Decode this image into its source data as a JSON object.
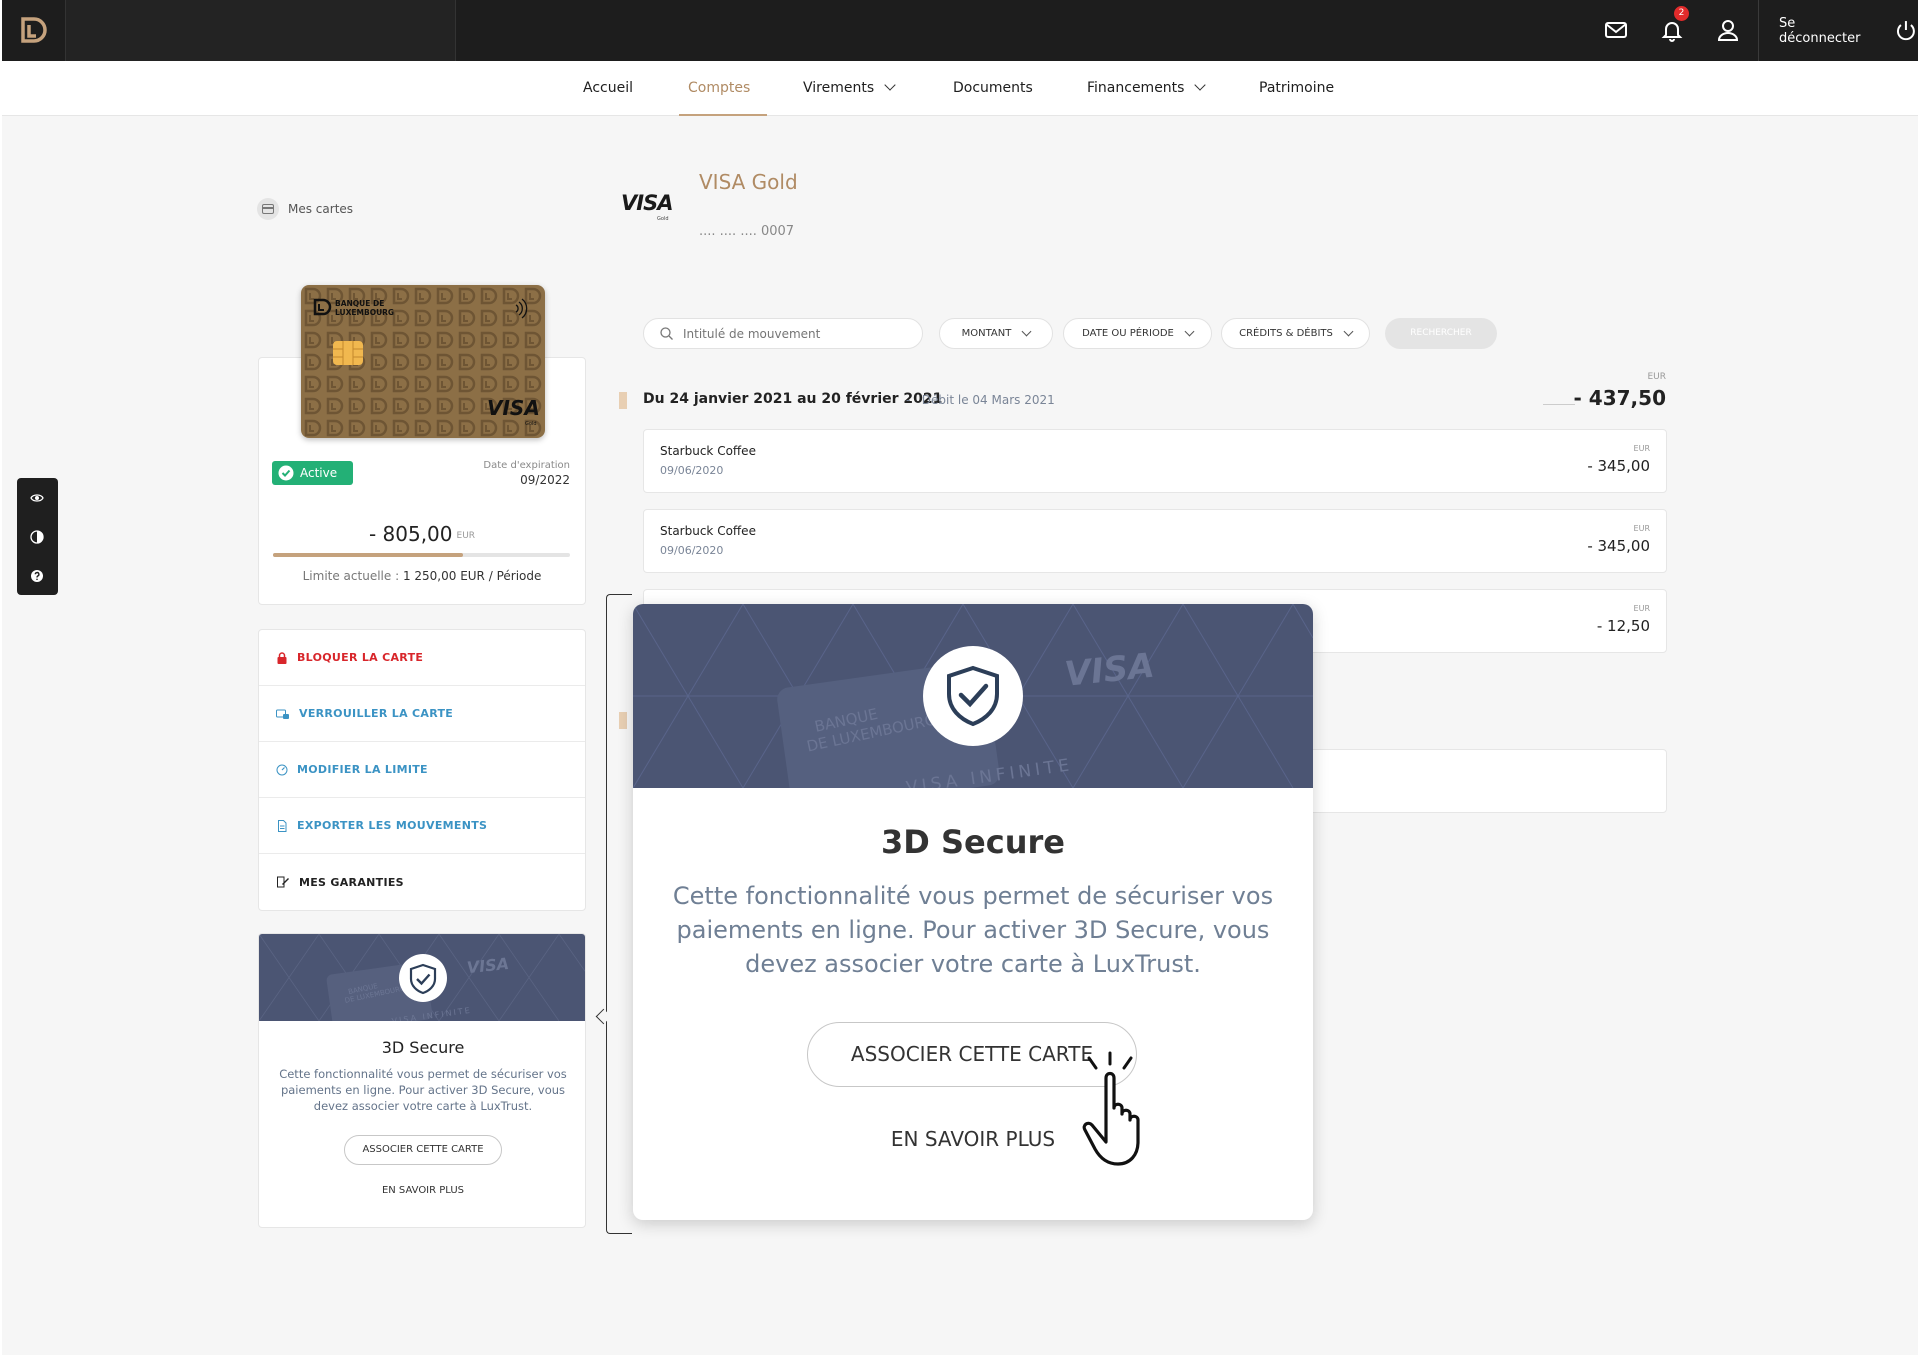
{
  "colors": {
    "accent": "#b08b64",
    "topbar": "#1d1d1d",
    "banner": "#4b5573",
    "danger": "#d8262b",
    "link": "#3b93c4",
    "success": "#23b076"
  },
  "topbar": {
    "logout_label": "Se déconnecter",
    "notifications_count": "2",
    "icons": [
      "mail-icon",
      "bell-icon",
      "user-icon",
      "power-icon"
    ]
  },
  "nav": {
    "items": [
      {
        "label": "Accueil"
      },
      {
        "label": "Comptes"
      },
      {
        "label": "Virements"
      },
      {
        "label": "Documents"
      },
      {
        "label": "Financements"
      },
      {
        "label": "Patrimoine"
      }
    ],
    "active": "Comptes"
  },
  "sidebar": {
    "title": "Mes cartes",
    "card": {
      "bank_line1": "BANQUE DE",
      "bank_line2": "LUXEMBOURG",
      "brand": "VISA",
      "brand_sub": "Gold",
      "status": "Active",
      "expiry_label": "Date d'expiration",
      "expiry": "09/2022",
      "balance": "- 805,00",
      "currency": "EUR",
      "limit_usage_fraction": 0.64,
      "limit_label": "Limite actuelle :",
      "limit_value": "1 250,00 EUR / Période"
    },
    "actions": [
      {
        "label": "BLOQUER LA CARTE"
      },
      {
        "label": "VERROUILLER LA CARTE"
      },
      {
        "label": "MODIFIER LA LIMITE"
      },
      {
        "label": "EXPORTER LES MOUVEMENTS"
      },
      {
        "label": "MES GARANTIES"
      }
    ],
    "secure": {
      "title": "3D Secure",
      "text": "Cette fonctionnalité vous permet de sécuriser vos paiements en ligne. Pour activer 3D Secure, vous devez associer votre carte à LuxTrust.",
      "button": "ASSOCIER CETTE CARTE",
      "link": "EN SAVOIR PLUS",
      "banner_bank1": "BANQUE",
      "banner_bank2": "DE LUXEMBOURG",
      "banner_brand": "VISA",
      "banner_tier": "VISA INFINITE"
    }
  },
  "card_header": {
    "logo": "VISA",
    "logo_sub": "Gold",
    "title": "VISA Gold",
    "number": ".... .... .... 0007"
  },
  "filters": {
    "search_placeholder": "Intitulé de mouvement",
    "montant": "MONTANT",
    "date": "DATE OU PÉRIODE",
    "credits": "CRÉDITS & DÉBITS",
    "search_button": "RECHERCHER"
  },
  "period": {
    "title": "Du 24 janvier 2021 au 20 février 2021",
    "separator": "-",
    "debit": "Débit le 04 Mars 2021",
    "currency": "EUR",
    "total": "- 437,50"
  },
  "transactions": [
    {
      "name": "Starbuck Coffee",
      "date": "09/06/2020",
      "currency": "EUR",
      "amount": "- 345,00"
    },
    {
      "name": "Starbuck Coffee",
      "date": "09/06/2020",
      "currency": "EUR",
      "amount": "- 345,00"
    },
    {
      "name": "",
      "date": "",
      "currency": "EUR",
      "amount": "- 12,50"
    }
  ],
  "modal": {
    "title": "3D Secure",
    "text": "Cette fonctionnalité vous permet de sécuriser vos paiements en ligne. Pour activer 3D Secure, vous devez associer votre carte à LuxTrust.",
    "button": "ASSOCIER CETTE CARTE",
    "link": "EN SAVOIR PLUS",
    "banner_bank1": "BANQUE",
    "banner_bank2": "DE LUXEMBOURG",
    "banner_brand": "VISA",
    "banner_tier": "VISA INFINITE"
  }
}
